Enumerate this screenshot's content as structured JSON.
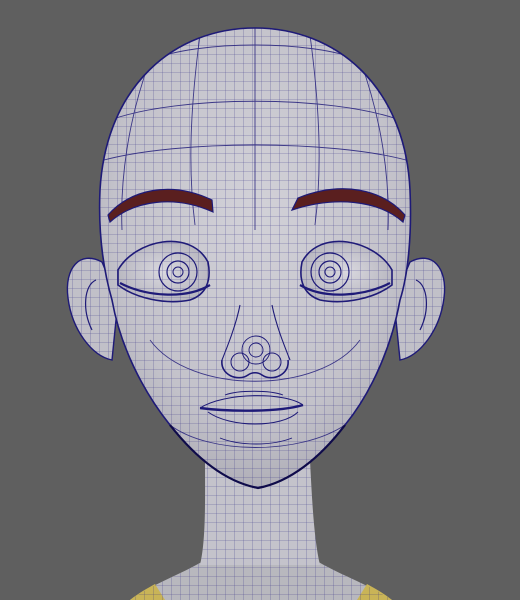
{
  "viewport": {
    "background_color": "#5f5f5f",
    "mesh_surface_color": "#c5c4cc",
    "wireframe_color": "#1e1a78",
    "brow_color": "#5a1f1f",
    "shirt_color": "#c9b457"
  },
  "scene": {
    "object": "head-wireframe-mesh",
    "parts": [
      "head",
      "left-ear",
      "right-ear",
      "left-eye",
      "right-eye",
      "left-eyebrow",
      "right-eyebrow",
      "nose",
      "mouth",
      "neck",
      "shirt-collar"
    ]
  }
}
